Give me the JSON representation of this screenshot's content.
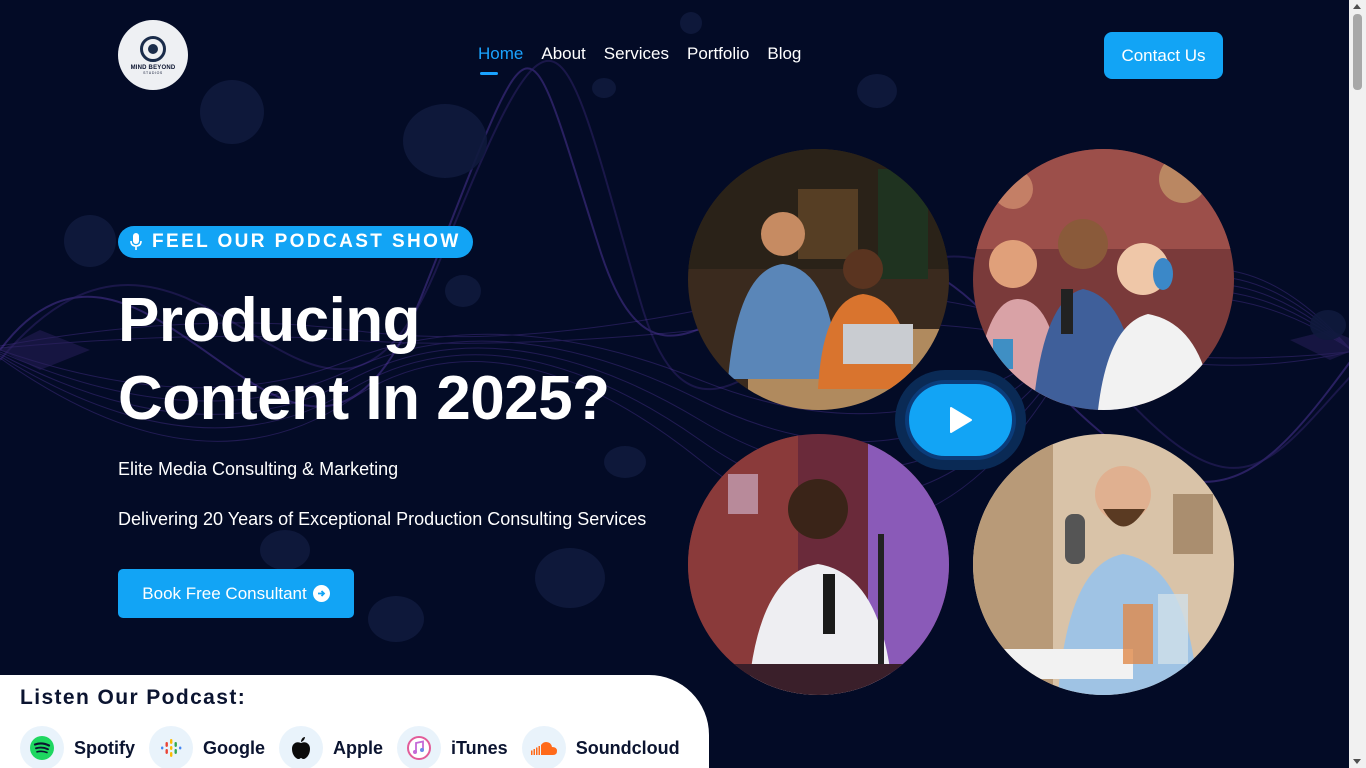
{
  "header": {
    "logo_text": "MIND BEYOND",
    "logo_sub": "STUDIOS",
    "nav": [
      {
        "label": "Home",
        "active": true
      },
      {
        "label": "About",
        "active": false
      },
      {
        "label": "Services",
        "active": false
      },
      {
        "label": "Portfolio",
        "active": false
      },
      {
        "label": "Blog",
        "active": false
      }
    ],
    "contact_label": "Contact Us"
  },
  "hero": {
    "badge": "FEEL OUR PODCAST SHOW",
    "title_line1": "Producing",
    "title_line2": "Content In 2025?",
    "subtitle1": "Elite Media Consulting & Marketing",
    "subtitle2": "Delivering 20 Years of Exceptional Production Consulting Services",
    "cta_label": "Book Free Consultant"
  },
  "listen": {
    "title": "Listen Our Podcast:",
    "platforms": [
      {
        "label": "Spotify",
        "icon": "spotify-icon"
      },
      {
        "label": "Google",
        "icon": "google-podcasts-icon"
      },
      {
        "label": "Apple",
        "icon": "apple-icon"
      },
      {
        "label": "iTunes",
        "icon": "itunes-icon"
      },
      {
        "label": "Soundcloud",
        "icon": "soundcloud-icon"
      }
    ]
  },
  "colors": {
    "background": "#030b26",
    "accent": "#12a4f5",
    "panel": "#ffffff"
  }
}
